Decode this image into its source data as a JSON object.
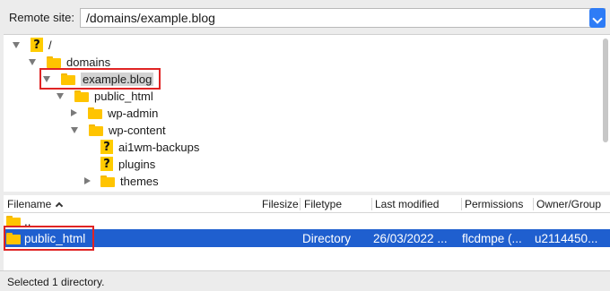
{
  "site_bar": {
    "label": "Remote site:",
    "value": "/domains/example.blog"
  },
  "tree": {
    "items": [
      {
        "label": "/",
        "icon": "question-icon"
      },
      {
        "label": "domains",
        "icon": "folder-icon"
      },
      {
        "label": "example.blog",
        "icon": "folder-icon",
        "selected": true
      },
      {
        "label": "public_html",
        "icon": "folder-icon"
      },
      {
        "label": "wp-admin",
        "icon": "folder-icon"
      },
      {
        "label": "wp-content",
        "icon": "folder-icon"
      },
      {
        "label": "ai1wm-backups",
        "icon": "question-icon"
      },
      {
        "label": "plugins",
        "icon": "question-icon"
      },
      {
        "label": "themes",
        "icon": "folder-icon"
      }
    ]
  },
  "list": {
    "columns": [
      "Filename",
      "Filesize",
      "Filetype",
      "Last modified",
      "Permissions",
      "Owner/Group"
    ],
    "rows": [
      {
        "name": "..",
        "size": "",
        "type": "",
        "modified": "",
        "permissions": "",
        "owner": ""
      },
      {
        "name": "public_html",
        "size": "",
        "type": "Directory",
        "modified": "26/03/2022 ...",
        "permissions": "flcdmpe (...",
        "owner": "u2114450...",
        "selected": true
      }
    ]
  },
  "status": {
    "text": "Selected 1 directory."
  },
  "colors": {
    "selection": "#1f5fcf",
    "highlight_box": "#e02424",
    "folder": "#ffc400"
  }
}
